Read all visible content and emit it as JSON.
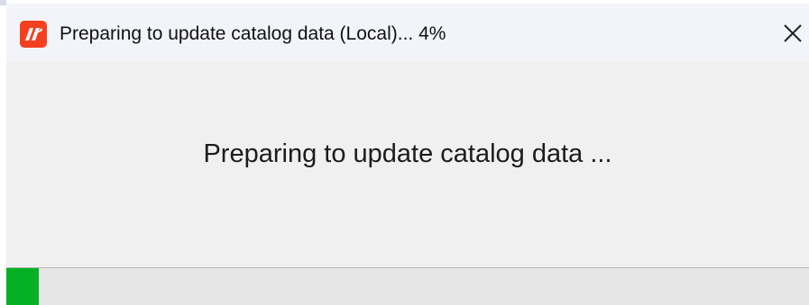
{
  "window": {
    "title": "Preparing to update catalog data (Local)... 4%",
    "icon": "app-logo-icon",
    "close_icon": "close-icon"
  },
  "main": {
    "message": "Preparing to update catalog data ..."
  },
  "progress": {
    "percent": 4,
    "fill_color": "#06b025"
  },
  "colors": {
    "app_icon": "#f5401f",
    "titlebar": "#f2f4f9",
    "body": "#f0f0f0"
  }
}
